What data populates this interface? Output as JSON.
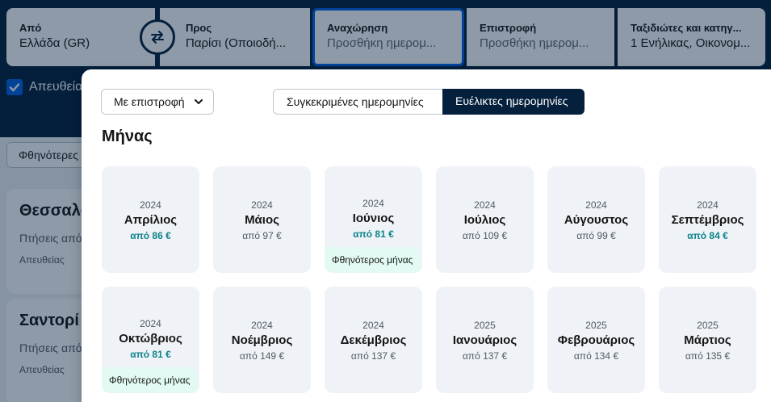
{
  "search": {
    "from": {
      "label": "Από",
      "value": "Ελλάδα (GR)"
    },
    "to": {
      "label": "Προς",
      "value": "Παρίσι (Οποιοδή..."
    },
    "departure": {
      "label": "Αναχώρηση",
      "placeholder": "Προσθήκη ημερομ..."
    },
    "return": {
      "label": "Επιστροφή",
      "placeholder": "Προσθήκη ημερομ..."
    },
    "travellers": {
      "label": "Ταξιδιώτες και κατηγ...",
      "value": "1 Ενήλικας, Οικονομ..."
    }
  },
  "background": {
    "direct_label": "Απευθεία",
    "cheapest_label": "Φθηνότερες",
    "destinations": [
      {
        "name": "Θεσσαλο",
        "subtitle": "Πτήσεις από",
        "type": "Απευθείας"
      },
      {
        "name": "Σαντορί",
        "subtitle": "Πτήσεις από",
        "type": "Απευθείας"
      }
    ]
  },
  "popup": {
    "trip_type": "Με επιστροφή",
    "toggle": {
      "specific": "Συγκεκριμένες ημερομηνίες",
      "flexible": "Ευέλικτες ημερομηνίες"
    },
    "section_title": "Μήνας",
    "months": [
      {
        "year": "2024",
        "month": "Απρίλιος",
        "price": "από 86 €",
        "cheap": true,
        "badge": ""
      },
      {
        "year": "2024",
        "month": "Μάιος",
        "price": "από 97 €",
        "cheap": false,
        "badge": ""
      },
      {
        "year": "2024",
        "month": "Ιούνιος",
        "price": "από 81 €",
        "cheap": true,
        "badge": "Φθηνότερος μήνας"
      },
      {
        "year": "2024",
        "month": "Ιούλιος",
        "price": "από 109 €",
        "cheap": false,
        "badge": ""
      },
      {
        "year": "2024",
        "month": "Αύγουστος",
        "price": "από 99 €",
        "cheap": false,
        "badge": ""
      },
      {
        "year": "2024",
        "month": "Σεπτέμβριος",
        "price": "από 84 €",
        "cheap": true,
        "badge": ""
      },
      {
        "year": "2024",
        "month": "Οκτώβριος",
        "price": "από 81 €",
        "cheap": true,
        "badge": "Φθηνότερος μήνας"
      },
      {
        "year": "2024",
        "month": "Νοέμβριος",
        "price": "από 149 €",
        "cheap": false,
        "badge": ""
      },
      {
        "year": "2024",
        "month": "Δεκέμβριος",
        "price": "από 137 €",
        "cheap": false,
        "badge": ""
      },
      {
        "year": "2025",
        "month": "Ιανουάριος",
        "price": "από 137 €",
        "cheap": false,
        "badge": ""
      },
      {
        "year": "2025",
        "month": "Φεβρουάριος",
        "price": "από 134 €",
        "cheap": false,
        "badge": ""
      },
      {
        "year": "2025",
        "month": "Μάρτιος",
        "price": "από 135 €",
        "cheap": false,
        "badge": ""
      }
    ]
  },
  "colors": {
    "brand_dark": "#05203c",
    "accent": "#0062e3",
    "cheap_price": "#0c838a",
    "badge_bg": "#e2faf3"
  }
}
